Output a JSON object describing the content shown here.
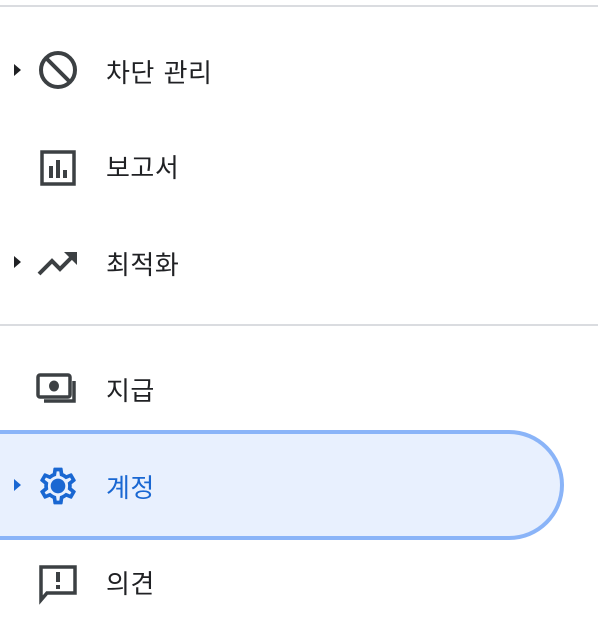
{
  "colors": {
    "text": "#202124",
    "icon": "#3c4043",
    "active_text": "#1967d2",
    "active_bg": "#e8f0fe",
    "active_border": "#8ab4f8",
    "active_bar": "#1a73e8",
    "divider": "#dadce0"
  },
  "nav": {
    "items": [
      {
        "label": "차단 관리",
        "icon": "block-icon",
        "expandable": true
      },
      {
        "label": "보고서",
        "icon": "bar-chart-icon",
        "expandable": false
      },
      {
        "label": "최적화",
        "icon": "trending-up-icon",
        "expandable": true
      },
      {
        "label": "지급",
        "icon": "payments-icon",
        "expandable": false
      },
      {
        "label": "계정",
        "icon": "gear-icon",
        "expandable": true,
        "selected": true
      },
      {
        "label": "의견",
        "icon": "feedback-icon",
        "expandable": false
      }
    ]
  }
}
